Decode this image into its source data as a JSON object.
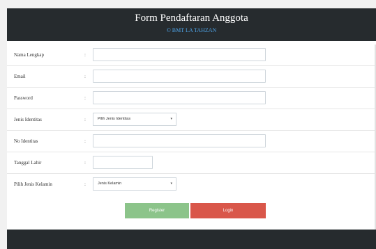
{
  "header": {
    "title": "Form Pendaftaran Anggota",
    "subtitle": "© BMT LA TAHZAN"
  },
  "fields": [
    {
      "label": "Nama Lengkap",
      "colon": ":",
      "type": "text",
      "value": ""
    },
    {
      "label": "Email",
      "colon": ":",
      "type": "text",
      "value": ""
    },
    {
      "label": "Password",
      "colon": ":",
      "type": "password",
      "value": ""
    },
    {
      "label": "Jenis Identitas",
      "colon": ":",
      "type": "select",
      "value": "Pilih Jenis Identitas"
    },
    {
      "label": "No Identitas",
      "colon": ":",
      "type": "text",
      "value": ""
    },
    {
      "label": "Tanggal Lahir",
      "colon": ":",
      "type": "date",
      "value": ""
    },
    {
      "label": "Pilih Jenis Kelamin",
      "colon": ":",
      "type": "select",
      "value": "Jenis Kelamin"
    }
  ],
  "select_caret": "▾",
  "buttons": {
    "register": "Register",
    "login": "Login"
  },
  "colors": {
    "header_bg": "#262b2e",
    "subtitle": "#4ea3e6",
    "register": "#8cc48a",
    "login": "#d9574a"
  }
}
